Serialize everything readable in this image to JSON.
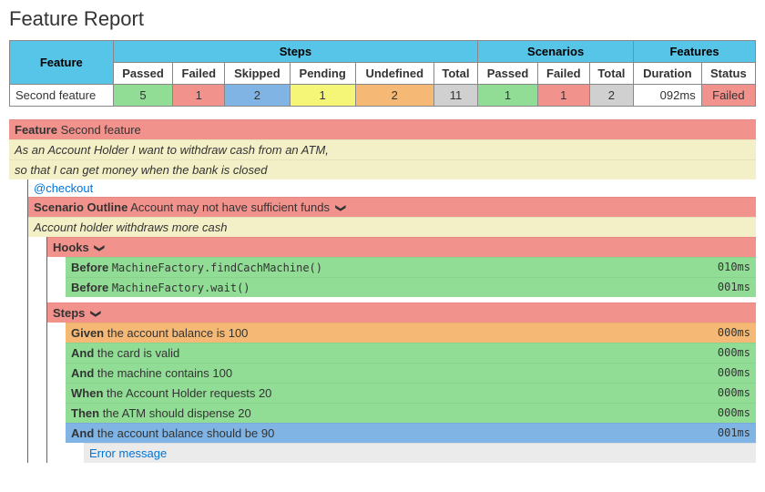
{
  "title": "Feature Report",
  "table": {
    "top_groups": [
      "Steps",
      "Scenarios",
      "Features"
    ],
    "feature_col": "Feature",
    "steps_cols": [
      "Passed",
      "Failed",
      "Skipped",
      "Pending",
      "Undefined",
      "Total"
    ],
    "scenarios_cols": [
      "Passed",
      "Failed",
      "Total"
    ],
    "features_cols": [
      "Duration",
      "Status"
    ],
    "row": {
      "feature": "Second feature",
      "steps": [
        "5",
        "1",
        "2",
        "1",
        "2",
        "11"
      ],
      "scenarios": [
        "1",
        "1",
        "2"
      ],
      "features": [
        "092ms",
        "Failed"
      ]
    }
  },
  "detail": {
    "feature_kw": "Feature",
    "feature_name": "Second feature",
    "story_line1": "As an Account Holder I want to withdraw cash from an ATM,",
    "story_line2": "so that I can get money when the bank is closed",
    "tag": "@checkout",
    "scenario_kw": "Scenario Outline",
    "scenario_name": "Account may not have sufficient funds",
    "scenario_desc": "Account holder withdraws more cash",
    "section_hooks": "Hooks",
    "section_steps": "Steps",
    "hooks": [
      {
        "kw": "Before",
        "loc": "MachineFactory.findCachMachine()",
        "time": "010ms"
      },
      {
        "kw": "Before",
        "loc": "MachineFactory.wait()",
        "time": "001ms"
      }
    ],
    "steps": [
      {
        "kw": "Given",
        "text": "the account balance is 100",
        "time": "000ms",
        "cls": "orange"
      },
      {
        "kw": "And",
        "text": "the card is valid",
        "time": "000ms",
        "cls": "green"
      },
      {
        "kw": "And",
        "text": "the machine contains 100",
        "time": "000ms",
        "cls": "green"
      },
      {
        "kw": "When",
        "text": "the Account Holder requests 20",
        "time": "000ms",
        "cls": "green"
      },
      {
        "kw": "Then",
        "text": "the ATM should dispense 20",
        "time": "000ms",
        "cls": "green"
      },
      {
        "kw": "And",
        "text": "the account balance should be 90",
        "time": "001ms",
        "cls": "blueL"
      }
    ],
    "error_msg": "Error message"
  }
}
